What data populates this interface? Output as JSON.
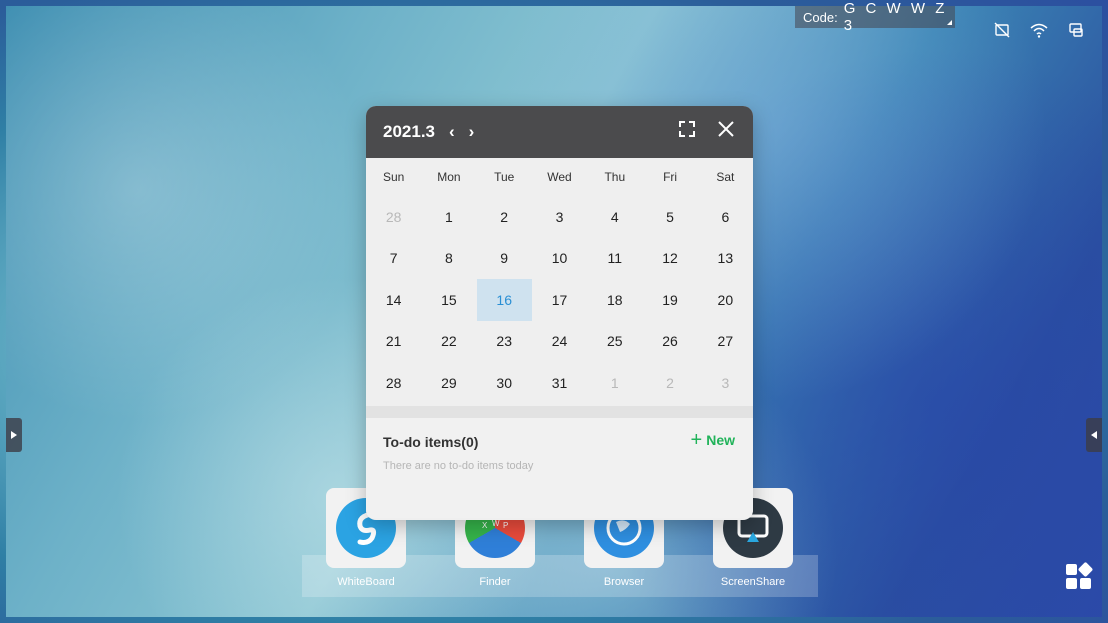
{
  "status_bar": {
    "code_label": "Code:",
    "code_value": "G C W W Z 3",
    "icons": [
      "screen-off-icon",
      "wifi-icon",
      "screen-mirror-icon"
    ]
  },
  "calendar": {
    "title": "2021.3",
    "prev": "‹",
    "next": "›",
    "weekdays": [
      "Sun",
      "Mon",
      "Tue",
      "Wed",
      "Thu",
      "Fri",
      "Sat"
    ],
    "weeks": [
      [
        "28",
        "1",
        "2",
        "3",
        "4",
        "5",
        "6"
      ],
      [
        "7",
        "8",
        "9",
        "10",
        "11",
        "12",
        "13"
      ],
      [
        "14",
        "15",
        "16",
        "17",
        "18",
        "19",
        "20"
      ],
      [
        "21",
        "22",
        "23",
        "24",
        "25",
        "26",
        "27"
      ],
      [
        "28",
        "29",
        "30",
        "31",
        "1",
        "2",
        "3"
      ]
    ],
    "selected_day": "16",
    "todo_title": "To-do items(0)",
    "todo_empty": "There are no to-do items today",
    "new_label": "New"
  },
  "dock": {
    "apps": [
      {
        "label": "WhiteBoard",
        "icon": "whiteboard-icon"
      },
      {
        "label": "Finder",
        "icon": "finder-icon"
      },
      {
        "label": "Browser",
        "icon": "browser-icon"
      },
      {
        "label": "ScreenShare",
        "icon": "screenshare-icon"
      }
    ]
  },
  "colors": {
    "calendar_header": "#4b4b4d",
    "selected_bg": "#cfe2ef",
    "selected_text": "#2a8fd4",
    "new_green": "#21b35a"
  }
}
